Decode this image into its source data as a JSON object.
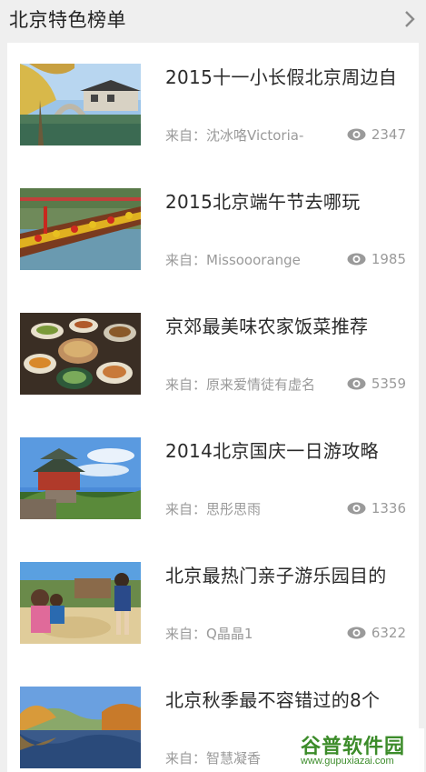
{
  "header": {
    "title": "北京特色榜单"
  },
  "items": [
    {
      "title": "2015十一小长假北京周边自",
      "source_prefix": "来自：",
      "author": "沈冰咯Victoria-",
      "views": "2347",
      "thumb": "water-town"
    },
    {
      "title": "2015北京端午节去哪玩",
      "source_prefix": "来自：",
      "author": "Missooorange",
      "views": "1985",
      "thumb": "dragon-boat"
    },
    {
      "title": "京郊最美味农家饭菜推荐",
      "source_prefix": "来自：",
      "author": "原来爱情徒有虚名",
      "views": "5359",
      "thumb": "farm-dishes"
    },
    {
      "title": "2014北京国庆一日游攻略",
      "source_prefix": "来自：",
      "author": "思彤思雨",
      "views": "1336",
      "thumb": "pagoda"
    },
    {
      "title": "北京最热门亲子游乐园目的",
      "source_prefix": "来自：",
      "author": "Q晶晶1",
      "views": "6322",
      "thumb": "kids-sand"
    },
    {
      "title": "北京秋季最不容错过的8个",
      "source_prefix": "来自：",
      "author": "智慧凝香",
      "views": "",
      "thumb": "autumn-lake"
    }
  ],
  "watermark": {
    "logo_text": "谷普软件园",
    "url": "www.gupuxiazai.com"
  },
  "colors": {
    "background": "#efefef",
    "card": "#ffffff",
    "title_text": "#2a2a2a",
    "meta_text": "#9a9a9a",
    "watermark_green": "#3c8c2a"
  },
  "icons": {
    "header_chevron": "chevron-right-icon",
    "views": "eye-icon"
  }
}
